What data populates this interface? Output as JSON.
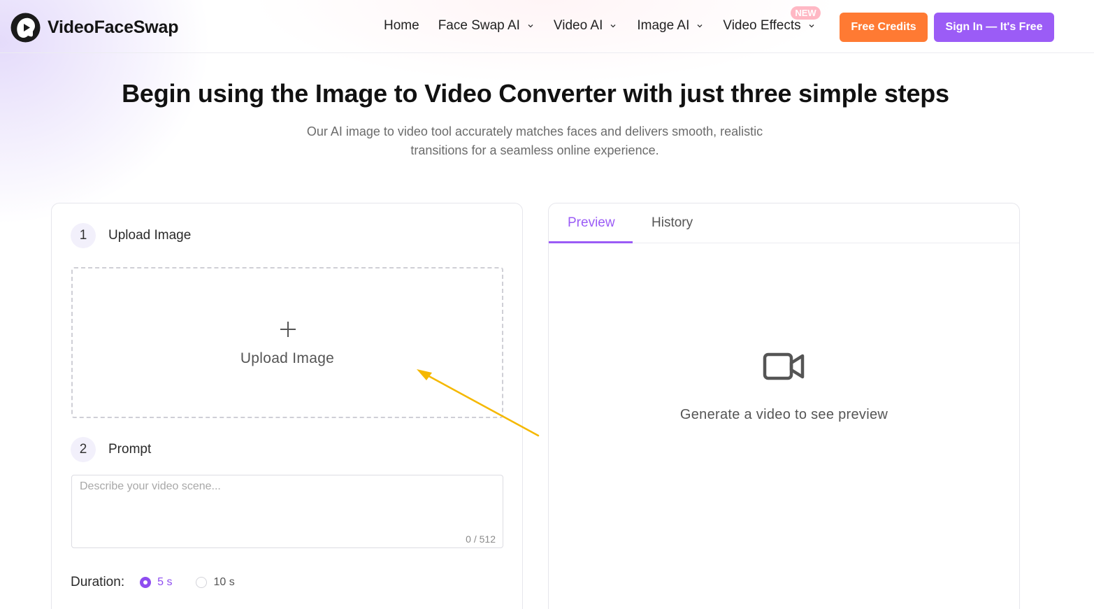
{
  "brand": {
    "name": "VideoFaceSwap"
  },
  "nav": {
    "home": "Home",
    "face_swap_ai": "Face Swap AI",
    "video_ai": "Video AI",
    "image_ai": "Image AI",
    "video_effects": "Video Effects",
    "new_badge": "NEW"
  },
  "header_buttons": {
    "free_credits": "Free Credits",
    "sign_in": "Sign In — It's Free"
  },
  "hero": {
    "title": "Begin using the Image to Video Converter with just three simple steps",
    "subtitle_line1": "Our AI image to video tool accurately matches faces and delivers smooth, realistic",
    "subtitle_line2": "transitions for a seamless online experience."
  },
  "steps": {
    "step1": {
      "number": "1",
      "label": "Upload Image"
    },
    "step2": {
      "number": "2",
      "label": "Prompt"
    }
  },
  "upload": {
    "label": "Upload Image"
  },
  "prompt": {
    "placeholder": "Describe your video scene...",
    "value": "",
    "char_count": "0 / 512"
  },
  "duration": {
    "label": "Duration:",
    "options": [
      {
        "label": "5 s",
        "selected": true
      },
      {
        "label": "10 s",
        "selected": false
      }
    ]
  },
  "preview_panel": {
    "tabs": {
      "preview": "Preview",
      "history": "History"
    },
    "active_tab": "Preview",
    "empty_message": "Generate a video to see preview"
  },
  "colors": {
    "accent_purple": "#9b5cf6",
    "credits_orange": "#ff7a33",
    "annotation_arrow": "#f5b800"
  }
}
